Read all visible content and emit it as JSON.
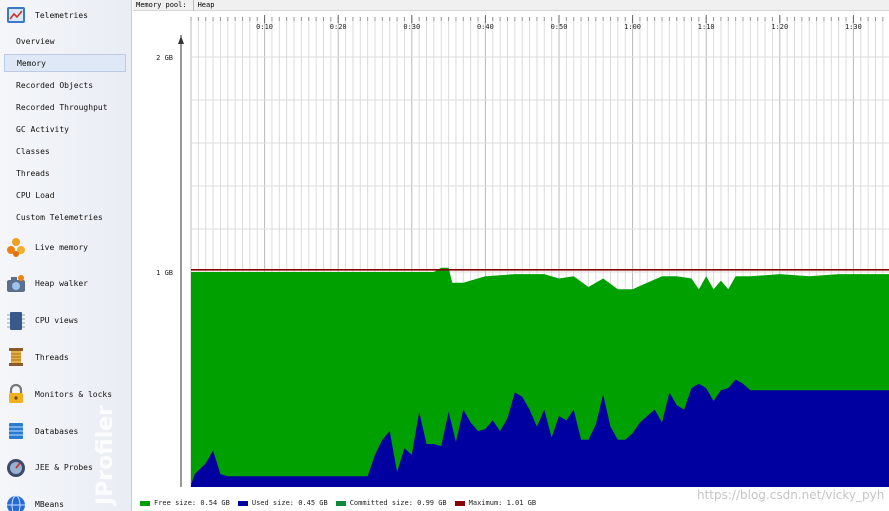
{
  "sidebar": {
    "telemetries": {
      "label": "Telemetries",
      "icon": "telemetries-icon"
    },
    "telemetry_items": [
      {
        "label": "Overview",
        "selected": false
      },
      {
        "label": "Memory",
        "selected": true
      },
      {
        "label": "Recorded Objects",
        "selected": false
      },
      {
        "label": "Recorded Throughput",
        "selected": false
      },
      {
        "label": "GC Activity",
        "selected": false
      },
      {
        "label": "Classes",
        "selected": false
      },
      {
        "label": "Threads",
        "selected": false
      },
      {
        "label": "CPU Load",
        "selected": false
      },
      {
        "label": "Custom Telemetries",
        "selected": false
      }
    ],
    "sections": [
      {
        "label": "Live memory",
        "icon": "live-memory-icon"
      },
      {
        "label": "Heap walker",
        "icon": "heap-walker-icon"
      },
      {
        "label": "CPU views",
        "icon": "cpu-views-icon"
      },
      {
        "label": "Threads",
        "icon": "threads-icon"
      },
      {
        "label": "Monitors & locks",
        "icon": "monitors-locks-icon"
      },
      {
        "label": "Databases",
        "icon": "databases-icon"
      },
      {
        "label": "JEE & Probes",
        "icon": "jee-probes-icon"
      },
      {
        "label": "MBeans",
        "icon": "mbeans-icon"
      }
    ],
    "watermark": "JProfiler"
  },
  "topbar": {
    "pool_label": "Memory pool:",
    "pool_value": "Heap"
  },
  "colors": {
    "free": "#00a000",
    "used": "#0000a0",
    "committed": "#0a8a3a",
    "maximum": "#8b0000"
  },
  "chart_data": {
    "type": "area",
    "x_unit": "minutes",
    "x_ticks": [
      "0:10",
      "0:20",
      "0:30",
      "0:40",
      "0:50",
      "1:00",
      "1:10",
      "1:20",
      "1:30"
    ],
    "y_ticks": [
      "2 GB",
      "1 GB"
    ],
    "ylim": [
      0,
      2.1
    ],
    "maximum": 1.01,
    "series": [
      {
        "name": "Used size",
        "x": [
          0,
          0.5,
          2,
          3,
          4,
          5,
          8,
          12,
          16,
          20,
          24,
          25,
          26,
          27,
          28,
          29,
          30,
          31,
          32,
          33,
          34,
          35,
          36,
          37,
          38,
          39,
          40,
          41,
          42,
          43,
          44,
          45,
          46,
          47,
          48,
          49,
          50,
          51,
          52,
          53,
          54,
          55,
          56,
          57,
          58,
          59,
          60,
          61,
          62,
          63,
          64,
          65,
          66,
          67,
          68,
          69,
          70,
          71,
          72,
          73,
          74,
          75,
          76,
          77,
          78,
          79,
          80,
          81,
          82,
          83,
          84,
          85,
          86,
          87,
          88,
          89,
          90,
          91,
          92,
          93,
          94,
          95
        ],
        "values": [
          0.01,
          0.06,
          0.11,
          0.17,
          0.06,
          0.05,
          0.05,
          0.05,
          0.05,
          0.05,
          0.05,
          0.15,
          0.22,
          0.26,
          0.07,
          0.18,
          0.15,
          0.35,
          0.2,
          0.2,
          0.19,
          0.35,
          0.21,
          0.36,
          0.3,
          0.26,
          0.27,
          0.31,
          0.26,
          0.32,
          0.44,
          0.42,
          0.36,
          0.28,
          0.36,
          0.23,
          0.33,
          0.31,
          0.36,
          0.22,
          0.22,
          0.29,
          0.43,
          0.28,
          0.22,
          0.22,
          0.25,
          0.3,
          0.33,
          0.36,
          0.3,
          0.44,
          0.38,
          0.36,
          0.46,
          0.48,
          0.46,
          0.4,
          0.45,
          0.46,
          0.5,
          0.48,
          0.45,
          0.45,
          0.45,
          0.45,
          0.45,
          0.45,
          0.45,
          0.45,
          0.45,
          0.45,
          0.45,
          0.45,
          0.45,
          0.45,
          0.45,
          0.45,
          0.45,
          0.45,
          0.45,
          0.45
        ]
      },
      {
        "name": "Committed size",
        "x": [
          0,
          33,
          34,
          35,
          35.5,
          37,
          40,
          44,
          48,
          50,
          52,
          54,
          56,
          58,
          60,
          64,
          66,
          68,
          69,
          70,
          71,
          72,
          73,
          74,
          76,
          80,
          84,
          88,
          95
        ],
        "values": [
          1.0,
          1.0,
          1.02,
          1.02,
          0.95,
          0.95,
          0.98,
          0.99,
          0.99,
          0.97,
          0.98,
          0.93,
          0.97,
          0.92,
          0.92,
          0.98,
          0.98,
          0.97,
          0.92,
          0.98,
          0.92,
          0.96,
          0.92,
          0.98,
          0.98,
          0.99,
          0.98,
          0.99,
          0.99
        ]
      }
    ],
    "legend": [
      {
        "label": "Free size: 0.54 GB",
        "color_key": "free"
      },
      {
        "label": "Used size: 0.45 GB",
        "color_key": "used"
      },
      {
        "label": "Committed size: 0.99 GB",
        "color_key": "committed"
      },
      {
        "label": "Maximum: 1.01 GB",
        "color_key": "maximum"
      }
    ]
  },
  "watermark_url": "https://blog.csdn.net/vicky_pyh"
}
